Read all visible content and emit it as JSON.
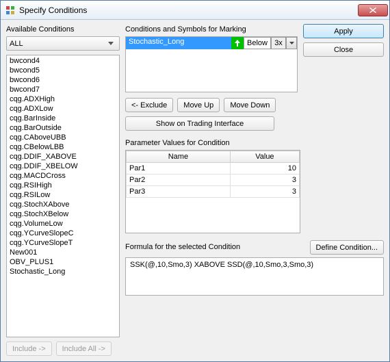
{
  "window": {
    "title": "Specify Conditions"
  },
  "left": {
    "label": "Available Conditions",
    "filter": "ALL",
    "items": [
      "bwcond4",
      "bwcond5",
      "bwcond6",
      "bwcond7",
      "cqg.ADXHigh",
      "cqg.ADXLow",
      "cqg.BarInside",
      "cqg.BarOutside",
      "cqg.CAboveUBB",
      "cqg.CBelowLBB",
      "cqg.DDIF_XABOVE",
      "cqg.DDIF_XBELOW",
      "cqg.MACDCross",
      "cqg.RSIHigh",
      "cqg.RSILow",
      "cqg.StochXAbove",
      "cqg.StochXBelow",
      "cqg.VolumeLow",
      "cqg.YCurveSlopeC",
      "cqg.YCurveSlopeT",
      "New001",
      "OBV_PLUS1",
      "Stochastic_Long"
    ],
    "include": "Include ->",
    "include_all": "Include All ->"
  },
  "marking": {
    "label": "Conditions and Symbols for Marking",
    "items": [
      {
        "name": "Stochastic_Long",
        "arrow": "up",
        "position": "Below",
        "count": "3x"
      }
    ],
    "exclude": "<- Exclude",
    "move_up": "Move Up",
    "move_down": "Move Down",
    "show_trade": "Show on Trading Interface"
  },
  "buttons": {
    "apply": "Apply",
    "close": "Close",
    "define": "Define Condition..."
  },
  "params": {
    "label": "Parameter Values for Condition",
    "headers": {
      "name": "Name",
      "value": "Value"
    },
    "rows": [
      {
        "name": "Par1",
        "value": "10"
      },
      {
        "name": "Par2",
        "value": "3"
      },
      {
        "name": "Par3",
        "value": "3"
      }
    ]
  },
  "formula": {
    "label": "Formula for the selected Condition",
    "text": "SSK(@,10,Smo,3) XABOVE  SSD(@,10,Smo,3,Smo,3)"
  }
}
